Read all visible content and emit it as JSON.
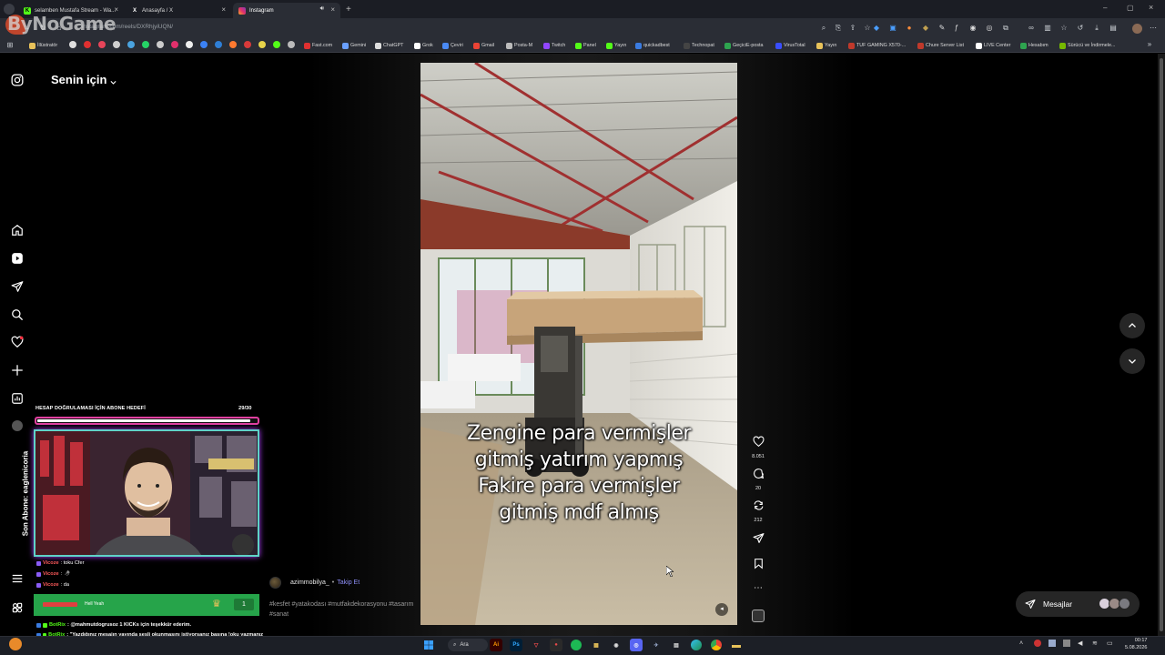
{
  "watermark": "ByNoGame",
  "tabs": [
    {
      "label": "selamben Mustafa Stream - Wa...",
      "icon_color": "#53fc18",
      "icon": "K"
    },
    {
      "label": "Anasayfa / X",
      "icon_color": "#ffffff",
      "icon": "X"
    },
    {
      "label": "Instagram",
      "icon_color": "#e1306c",
      "icon": "instagram-icon"
    }
  ],
  "address": {
    "url": "instagram.com/reels/DXRhjyiUQN/"
  },
  "bookmarks": [
    "İllüstratör",
    "Fast.com",
    "Gemini",
    "ChatGPT",
    "Grok",
    "Çeviri",
    "Gmail",
    "Posta-M",
    "Twitch",
    "Panel",
    "Yayın",
    "quickadbest",
    "Technopat",
    "GeçiciE-posta",
    "VirusTotal",
    "Yayın",
    "TUF GAMING X570-...",
    "Chure Server List",
    "LIVE Center",
    "Hesabım",
    "Sürücü ve İndirmele..."
  ],
  "instagram": {
    "feed_selector": "Senin için",
    "reel": {
      "overlay_lines": [
        "Zengine para vermişler",
        "gitmiş yatırım yapmış",
        "Fakire para vermişler",
        "gitmiş mdf almış"
      ],
      "likes": "8.051",
      "comments": "20",
      "reposts": "212",
      "author": "azimmobilya_",
      "separator": "•",
      "follow": "Takip Et",
      "caption": "#kesfet #yatakodası #mutfakdekorasyonu #tasarım #sanat"
    },
    "messages": "Mesajlar"
  },
  "stream_overlay": {
    "goal_title": "HESAP DOĞRULAMASI İÇİN ABONE HEDEFİ",
    "goal_count": "29/30",
    "goal_progress": 0.97,
    "last_sub": "Son Abone: eaglenicoria",
    "chat": [
      {
        "user": "Vicoze",
        "msg": ": toku Cfer",
        "color": "#ff5a5a"
      },
      {
        "user": "Vicoze",
        "msg": ":",
        "color": "#ff5a5a"
      },
      {
        "user": "Vicoze",
        "msg": ": da",
        "color": "#ff5a5a"
      },
      {
        "user": "BotRix",
        "msg": ": @mahmutdogrusoz 1 KICKs için teşekkür ederim.",
        "color": "#53fc18"
      },
      {
        "user": "BotRix",
        "msg": ": \"Yazdığınız mesajın yayında sesli okunmasını istiyorsanız başına !oku yazmanız yeterli!\"",
        "color": "#53fc18"
      }
    ],
    "hell_label": "Hell Yeah",
    "hell_count": "1"
  },
  "taskbar": {
    "search": "Ara",
    "time": "00:17",
    "date": "5.08.2026"
  }
}
